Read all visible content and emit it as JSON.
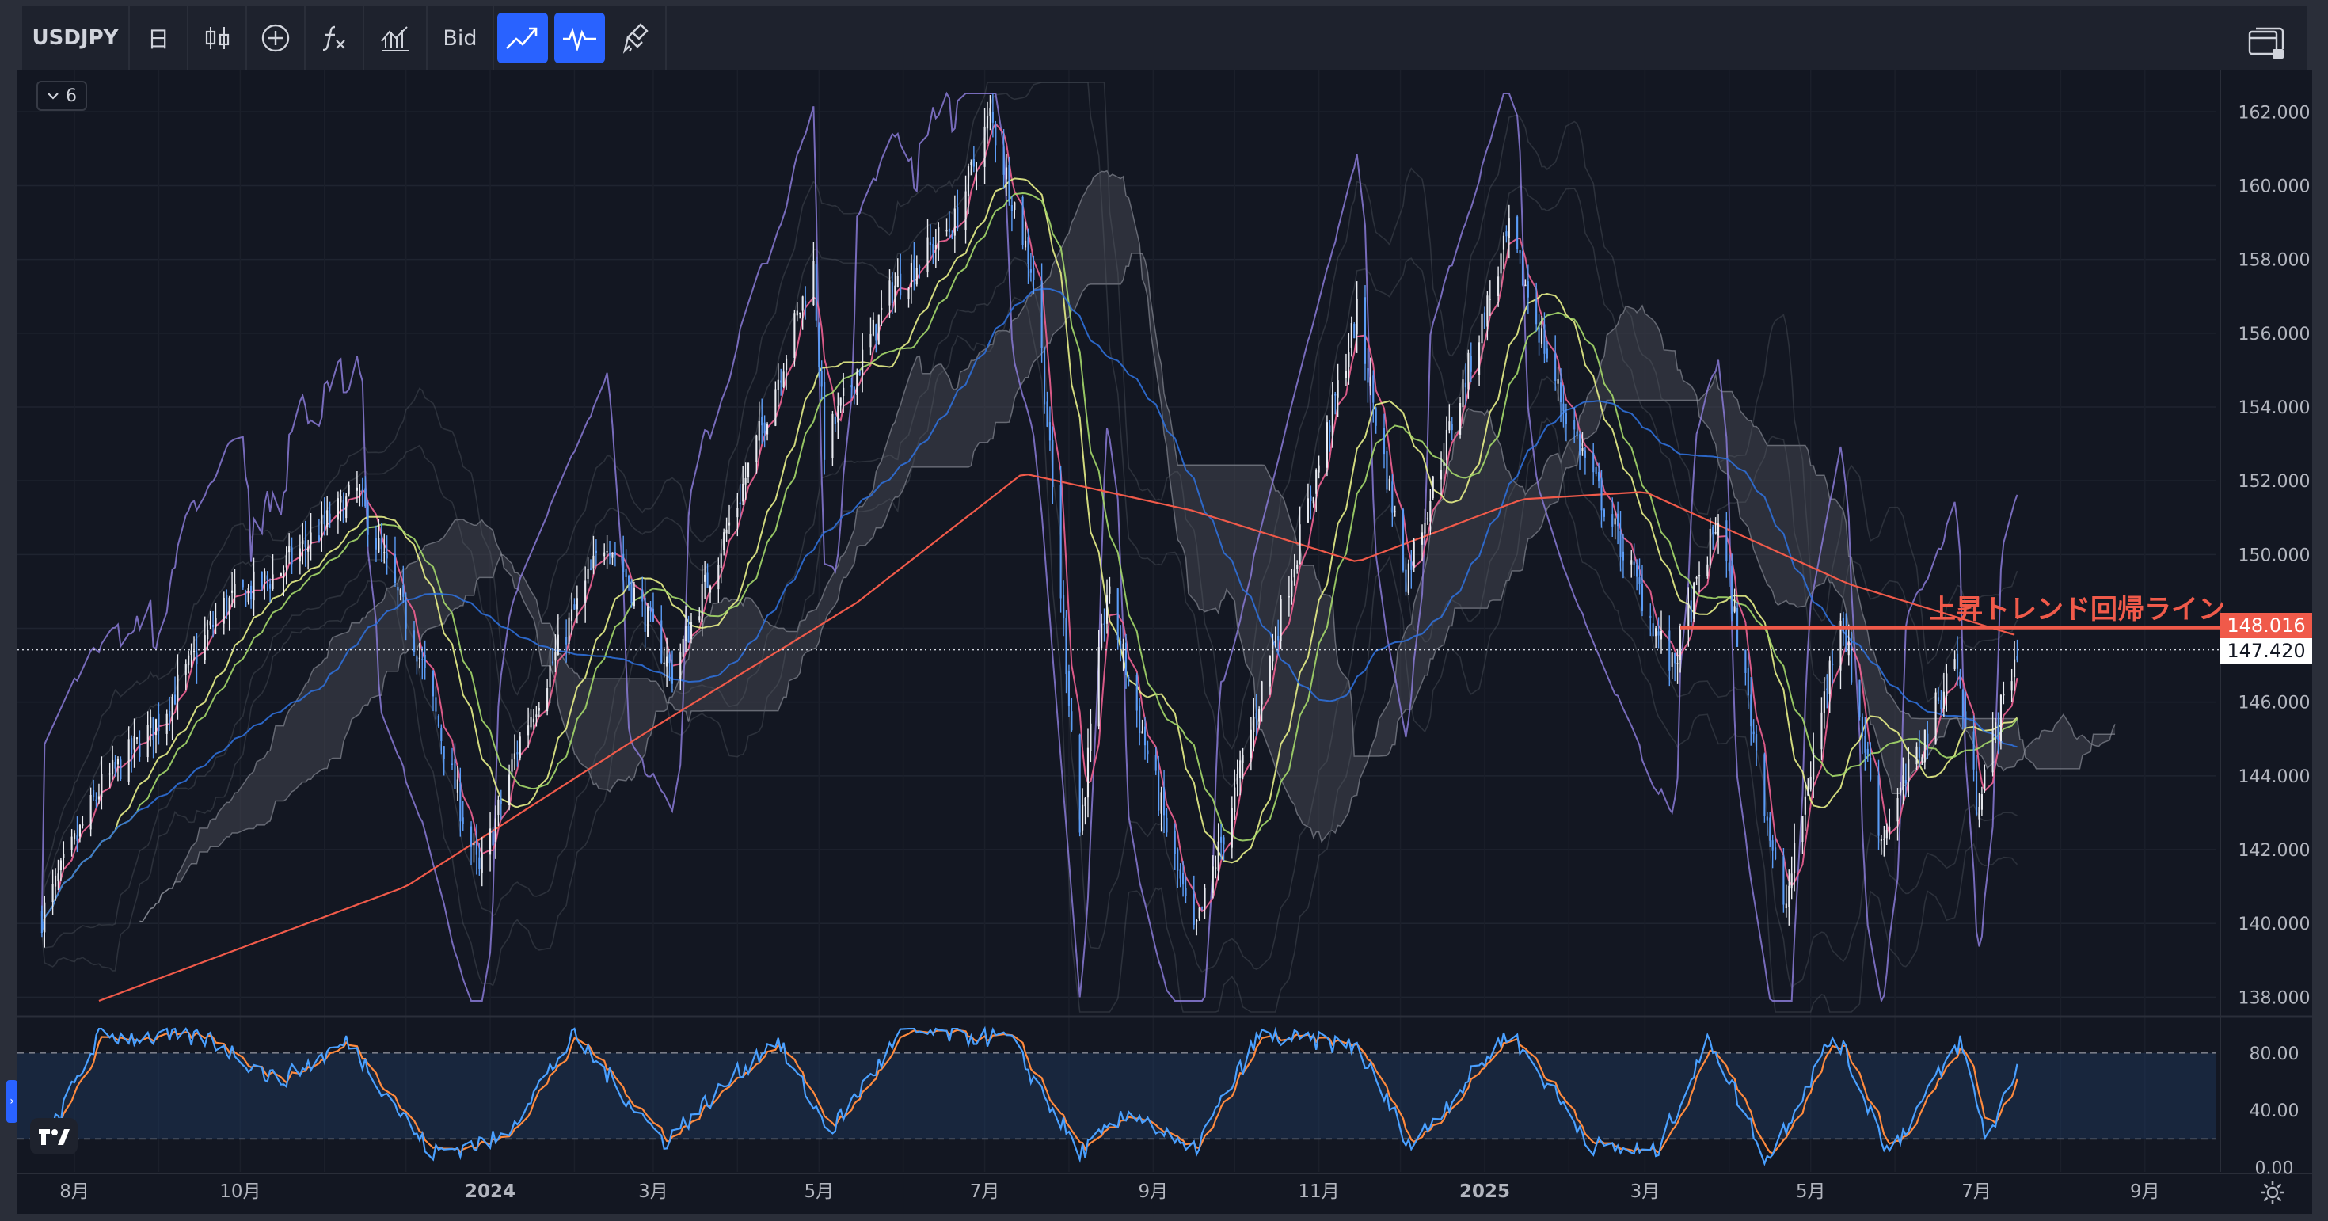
{
  "toolbar": {
    "symbol": "USDJPY",
    "interval_label": "日",
    "price_type": "Bid",
    "icons": [
      "bar-style-icon",
      "add-compare-icon",
      "indicators-icon",
      "templates-icon",
      "line-tool-icon",
      "pulse-tool-icon",
      "eraser-brush-icon",
      "layout-icon"
    ]
  },
  "collapse": {
    "count": "6"
  },
  "annotation": {
    "label": "上昇トレンド回帰ライン",
    "price_tag": "148.016",
    "current_price_tag": "147.420"
  },
  "colors": {
    "up": "#e8eaf0",
    "down": "#5b9cf6",
    "ma_fast": "#f06292",
    "ma_mid": "#e8ef88",
    "ma_slow": "#a5d86a",
    "ma_75": "#2f6fd8",
    "ma_200": "#f05a4a",
    "rci": "#8a7ad6",
    "stoch_k": "#4aa0ff",
    "stoch_d": "#ff8a3d",
    "trendline": "#f05a4a",
    "stoch_band": "#1e3a5f"
  },
  "chart_data": [
    {
      "type": "candlestick",
      "title": "USDJPY",
      "x_tick_labels": [
        "8月",
        "10月",
        "2024",
        "3月",
        "5月",
        "7月",
        "9月",
        "11月",
        "2025",
        "3月",
        "5月",
        "7月",
        "9月"
      ],
      "y_tick_labels": [
        "162.000",
        "160.000",
        "158.000",
        "156.000",
        "154.000",
        "152.000",
        "150.000",
        "148.000",
        "146.000",
        "144.000",
        "142.000",
        "140.000",
        "138.000"
      ],
      "ylim": [
        137.6,
        162.8
      ],
      "horizontal_line": {
        "value": 148.016,
        "label": "上昇トレンド回帰ライン"
      },
      "current_price": 147.42,
      "close_path": [
        [
          "2023-07-20",
          140.2
        ],
        [
          "2023-08-10",
          143.6
        ],
        [
          "2023-09-01",
          145.5
        ],
        [
          "2023-09-25",
          148.6
        ],
        [
          "2023-10-15",
          149.5
        ],
        [
          "2023-11-13",
          151.7
        ],
        [
          "2023-12-05",
          147.5
        ],
        [
          "2023-12-28",
          141.3
        ],
        [
          "2024-01-12",
          145.0
        ],
        [
          "2024-02-13",
          150.5
        ],
        [
          "2024-03-08",
          146.8
        ],
        [
          "2024-04-01",
          151.4
        ],
        [
          "2024-04-29",
          157.8
        ],
        [
          "2024-05-03",
          152.9
        ],
        [
          "2024-05-28",
          157.2
        ],
        [
          "2024-06-20",
          159.0
        ],
        [
          "2024-07-03",
          161.9
        ],
        [
          "2024-07-20",
          157.3
        ],
        [
          "2024-08-05",
          142.5
        ],
        [
          "2024-08-15",
          149.0
        ],
        [
          "2024-09-16",
          139.6
        ],
        [
          "2024-10-01",
          143.5
        ],
        [
          "2024-11-15",
          156.5
        ],
        [
          "2024-12-03",
          149.4
        ],
        [
          "2025-01-10",
          158.7
        ],
        [
          "2025-01-30",
          154.0
        ],
        [
          "2025-03-11",
          146.9
        ],
        [
          "2025-03-28",
          151.0
        ],
        [
          "2025-04-21",
          140.2
        ],
        [
          "2025-05-12",
          148.5
        ],
        [
          "2025-05-27",
          142.3
        ],
        [
          "2025-06-13",
          145.2
        ],
        [
          "2025-06-23",
          147.3
        ],
        [
          "2025-07-01",
          143.3
        ],
        [
          "2025-07-16",
          147.42
        ]
      ],
      "ma_200_path": [
        [
          "2023-08-10",
          137.9
        ],
        [
          "2023-12-01",
          141.0
        ],
        [
          "2024-03-01",
          145.3
        ],
        [
          "2024-05-15",
          148.7
        ],
        [
          "2024-07-15",
          152.2
        ],
        [
          "2024-09-15",
          151.2
        ],
        [
          "2024-11-15",
          149.8
        ],
        [
          "2025-01-15",
          151.5
        ],
        [
          "2025-03-01",
          151.7
        ],
        [
          "2025-05-15",
          149.2
        ],
        [
          "2025-07-16",
          147.8
        ]
      ]
    },
    {
      "type": "line",
      "title": "",
      "y_tick_labels": [
        "80.00",
        "40.00",
        "0.00"
      ],
      "ylim": [
        -3,
        102
      ],
      "band": [
        20,
        80
      ],
      "stoch_path": [
        [
          "2023-07-20",
          12
        ],
        [
          "2023-08-10",
          92
        ],
        [
          "2023-09-20",
          90
        ],
        [
          "2023-10-15",
          60
        ],
        [
          "2023-11-10",
          88
        ],
        [
          "2023-12-10",
          10
        ],
        [
          "2024-01-05",
          20
        ],
        [
          "2024-02-01",
          92
        ],
        [
          "2024-03-05",
          18
        ],
        [
          "2024-04-15",
          90
        ],
        [
          "2024-05-05",
          25
        ],
        [
          "2024-06-01",
          95
        ],
        [
          "2024-07-10",
          90
        ],
        [
          "2024-08-05",
          10
        ],
        [
          "2024-08-25",
          40
        ],
        [
          "2024-09-15",
          8
        ],
        [
          "2024-10-10",
          92
        ],
        [
          "2024-11-15",
          85
        ],
        [
          "2024-12-05",
          15
        ],
        [
          "2025-01-10",
          95
        ],
        [
          "2025-02-10",
          15
        ],
        [
          "2025-03-05",
          10
        ],
        [
          "2025-03-25",
          90
        ],
        [
          "2025-04-15",
          5
        ],
        [
          "2025-05-10",
          95
        ],
        [
          "2025-05-30",
          10
        ],
        [
          "2025-06-25",
          88
        ],
        [
          "2025-07-05",
          18
        ],
        [
          "2025-07-16",
          72
        ]
      ]
    }
  ]
}
